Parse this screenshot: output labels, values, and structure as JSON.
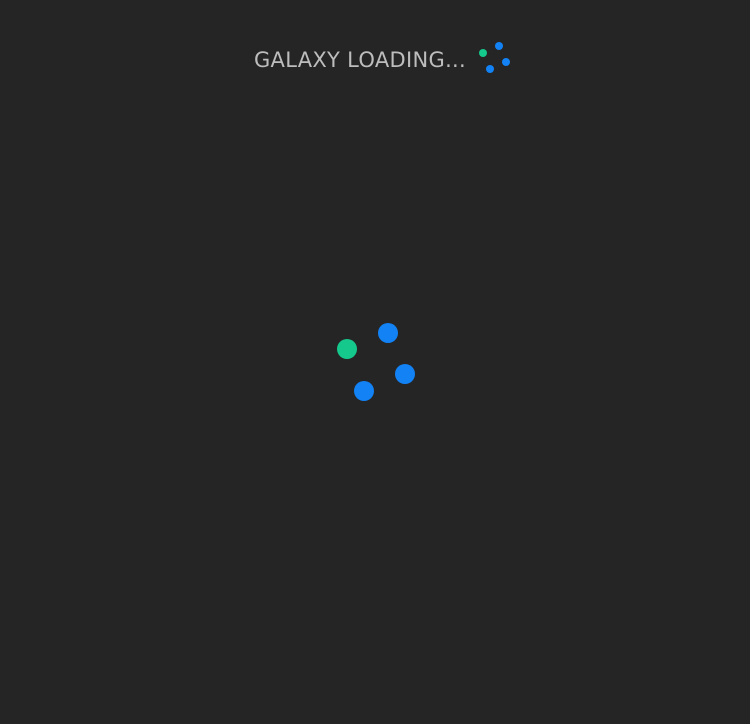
{
  "loader": {
    "title": "GALAXY LOADING...",
    "colors": {
      "background": "#252525",
      "text": "#bdbdbd",
      "accent_green": "#14c98b",
      "accent_blue": "#1282f5"
    },
    "spinner_icon": "loading-spinner-icon"
  }
}
